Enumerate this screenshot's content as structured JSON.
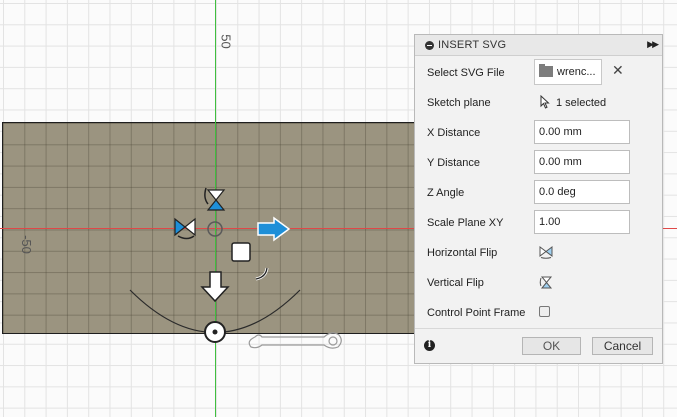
{
  "viewport": {
    "axis_label_top": "50",
    "axis_label_left": "-50"
  },
  "dialog": {
    "title": "INSERT SVG",
    "rows": {
      "select_file": {
        "label": "Select SVG File",
        "file_name": "wrenc..."
      },
      "sketch_plane": {
        "label": "Sketch plane",
        "value": "1 selected"
      },
      "x_distance": {
        "label": "X Distance",
        "value": "0.00 mm"
      },
      "y_distance": {
        "label": "Y Distance",
        "value": "0.00 mm"
      },
      "z_angle": {
        "label": "Z Angle",
        "value": "0.0 deg"
      },
      "scale": {
        "label": "Scale Plane XY",
        "value": "1.00"
      },
      "hflip": {
        "label": "Horizontal Flip"
      },
      "vflip": {
        "label": "Vertical Flip"
      },
      "cpframe": {
        "label": "Control Point Frame"
      }
    },
    "ok_label": "OK",
    "cancel_label": "Cancel"
  },
  "colors": {
    "plane": "#9b9480",
    "axis_x": "#e04848",
    "axis_y": "#3fbf3f",
    "manipulator": "#1e8fd8"
  },
  "icons": [
    "minus-circle-icon",
    "expand-icon",
    "folder-icon",
    "close-icon",
    "cursor-icon",
    "horizontal-flip-icon",
    "vertical-flip-icon",
    "info-icon"
  ]
}
